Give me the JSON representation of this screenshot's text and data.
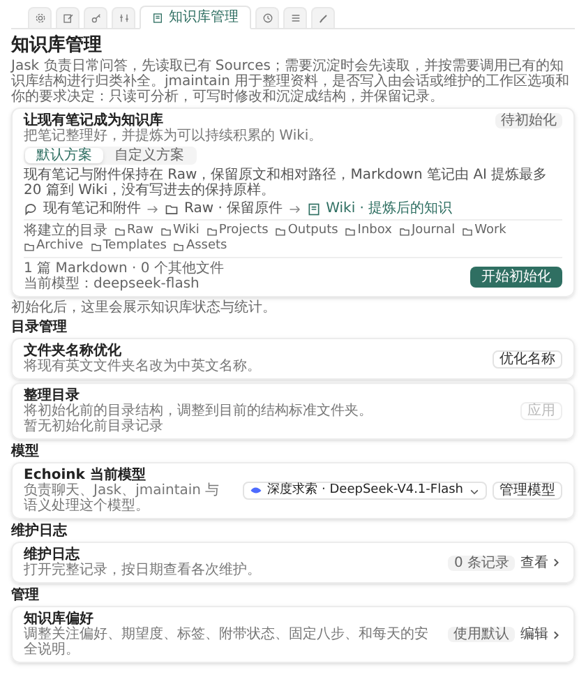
{
  "tabs": [
    {
      "kind": "gear",
      "selected": false
    },
    {
      "kind": "edit",
      "selected": false
    },
    {
      "kind": "key",
      "selected": false
    },
    {
      "kind": "sliders",
      "selected": false
    },
    {
      "kind": "book",
      "label": "知识库管理",
      "selected": true
    },
    {
      "kind": "clock",
      "selected": false
    },
    {
      "kind": "list",
      "selected": false
    },
    {
      "kind": "brush",
      "selected": false
    }
  ],
  "title": "知识库管理",
  "description": "Jask 负责日常问答，先读取已有 Sources；需要沉淀时会先读取，并按需要调用已有的知识库结构进行归类补全。jmaintain 用于整理资料，是否写入由会话或维护的工作区选项和你的要求决定：只读可分析，可写时修改和沉淀成结构，并保留记录。",
  "init_card": {
    "title": "让现有笔记成为知识库",
    "subtitle": "把笔记整理好，并提炼为可以持续积累的 Wiki。",
    "badge": "待初始化",
    "plans": [
      {
        "label": "默认方案",
        "selected": true
      },
      {
        "label": "自定义方案",
        "selected": false
      }
    ],
    "plan_text": "现有笔记与附件保持在 Raw，保留原文和相对路径，Markdown 笔记由 AI 提炼最多 20 篇到 Wiki，没有写进去的保持原样。",
    "flow": [
      {
        "kind": "chat",
        "label": "现有笔记和附件"
      },
      {
        "kind": "folder",
        "label": "Raw · 保留原件"
      },
      {
        "kind": "book",
        "label": "Wiki · 提炼后的知识"
      }
    ],
    "folders_label": "将建立的目录",
    "folders": [
      "Raw",
      "Wiki",
      "Projects",
      "Outputs",
      "Inbox",
      "Journal",
      "Work",
      "Archive",
      "Templates",
      "Assets"
    ],
    "stats": "1 篇 Markdown · 0 个其他文件",
    "model": "当前模型：deepseek-flash",
    "button": "开始初始化"
  },
  "note": "初始化后，这里会展示知识库状态与统计。",
  "sections": [
    {
      "heading": "目录管理",
      "cards": [
        {
          "title": "文件夹名称优化",
          "lines": [
            "将现有英文文件夹名改为中英文名称。"
          ],
          "actions": [
            {
              "kind": "button",
              "label": "优化名称",
              "disabled": false
            }
          ]
        },
        {
          "title": "整理目录",
          "lines": [
            "将初始化前的目录结构，调整到目前的结构标准文件夹。",
            "暂无初始化前目录记录"
          ],
          "actions": [
            {
              "kind": "button",
              "label": "应用",
              "disabled": true
            }
          ]
        }
      ]
    },
    {
      "heading": "模型",
      "cards": [
        {
          "title": "Echoink 当前模型",
          "lines": [
            "负责聊天、Jask、jmaintain 与语义处理这个模型。"
          ],
          "actions": [
            {
              "kind": "select",
              "label": "深度求索 · DeepSeek-V4.1-Flash"
            },
            {
              "kind": "button",
              "label": "管理模型",
              "disabled": false
            }
          ]
        }
      ]
    },
    {
      "heading": "维护日志",
      "cards": [
        {
          "title": "维护日志",
          "lines": [
            "打开完整记录，按日期查看各次维护。"
          ],
          "actions": [
            {
              "kind": "badge",
              "label": "0 条记录"
            },
            {
              "kind": "link",
              "label": "查看"
            }
          ]
        }
      ]
    },
    {
      "heading": "管理",
      "cards": [
        {
          "title": "知识库偏好",
          "lines": [
            "调整关注偏好、期望度、标签、附带状态、固定八步、和每天的安全说明。"
          ],
          "actions": [
            {
              "kind": "badge",
              "label": "使用默认"
            },
            {
              "kind": "link",
              "label": "编辑"
            }
          ]
        }
      ]
    }
  ]
}
